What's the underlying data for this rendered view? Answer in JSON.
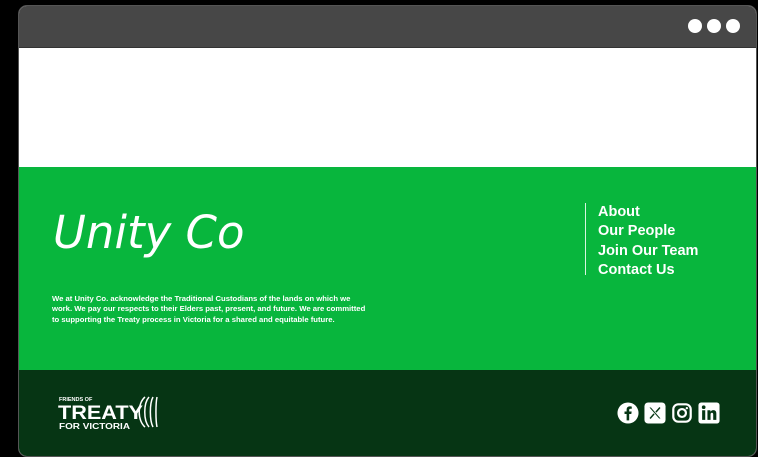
{
  "window": {
    "controls": [
      "menu-dot",
      "menu-dot",
      "menu-dot"
    ]
  },
  "footer": {
    "brand": "Unity Co.",
    "acknowledgement": "We at Unity Co. acknowledge the Traditional Custodians of the lands on which we work. We pay our respects to their Elders past, present, and future. We are committed to supporting the Treaty process in Victoria for a shared and equitable future.",
    "nav": [
      {
        "label": "About"
      },
      {
        "label": "Our People"
      },
      {
        "label": "Join Our Team"
      },
      {
        "label": "Contact Us"
      }
    ],
    "partner_logo": {
      "line1": "FRIENDS OF",
      "line2": "TREATY",
      "line3": "FOR VICTORIA"
    },
    "social": [
      {
        "icon": "facebook-icon"
      },
      {
        "icon": "x-icon"
      },
      {
        "icon": "instagram-icon"
      },
      {
        "icon": "linkedin-icon"
      }
    ]
  },
  "colors": {
    "green": "#08b63d",
    "dark_green": "#063514",
    "titlebar": "#474747",
    "text": "#ffffff"
  }
}
